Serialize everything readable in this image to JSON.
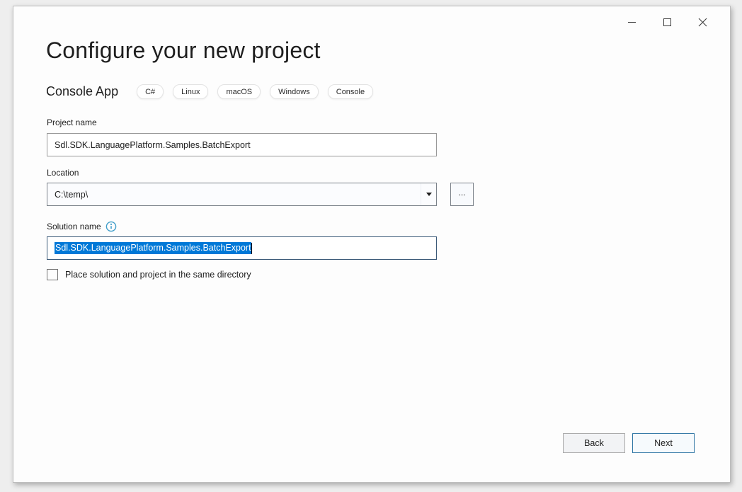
{
  "window": {
    "controls": [
      {
        "name": "minimize"
      },
      {
        "name": "maximize"
      },
      {
        "name": "close"
      }
    ]
  },
  "header": {
    "title": "Configure your new project"
  },
  "template": {
    "name": "Console App",
    "tags": [
      "C#",
      "Linux",
      "macOS",
      "Windows",
      "Console"
    ]
  },
  "form": {
    "project_name": {
      "label": "Project name",
      "value": "Sdl.SDK.LanguagePlatform.Samples.BatchExport"
    },
    "location": {
      "label": "Location",
      "value": "C:\\temp\\",
      "browse_label": "..."
    },
    "solution_name": {
      "label": "Solution name",
      "value": "Sdl.SDK.LanguagePlatform.Samples.BatchExport",
      "selected": true
    },
    "same_directory_checkbox": {
      "label": "Place solution and project in the same directory",
      "checked": false
    }
  },
  "footer": {
    "back_label": "Back",
    "next_label": "Next"
  },
  "colors": {
    "selection": "#0078d7",
    "focused_border": "#3c5a78",
    "next_border": "#2e75a4",
    "info_icon": "#3f9dc9"
  }
}
